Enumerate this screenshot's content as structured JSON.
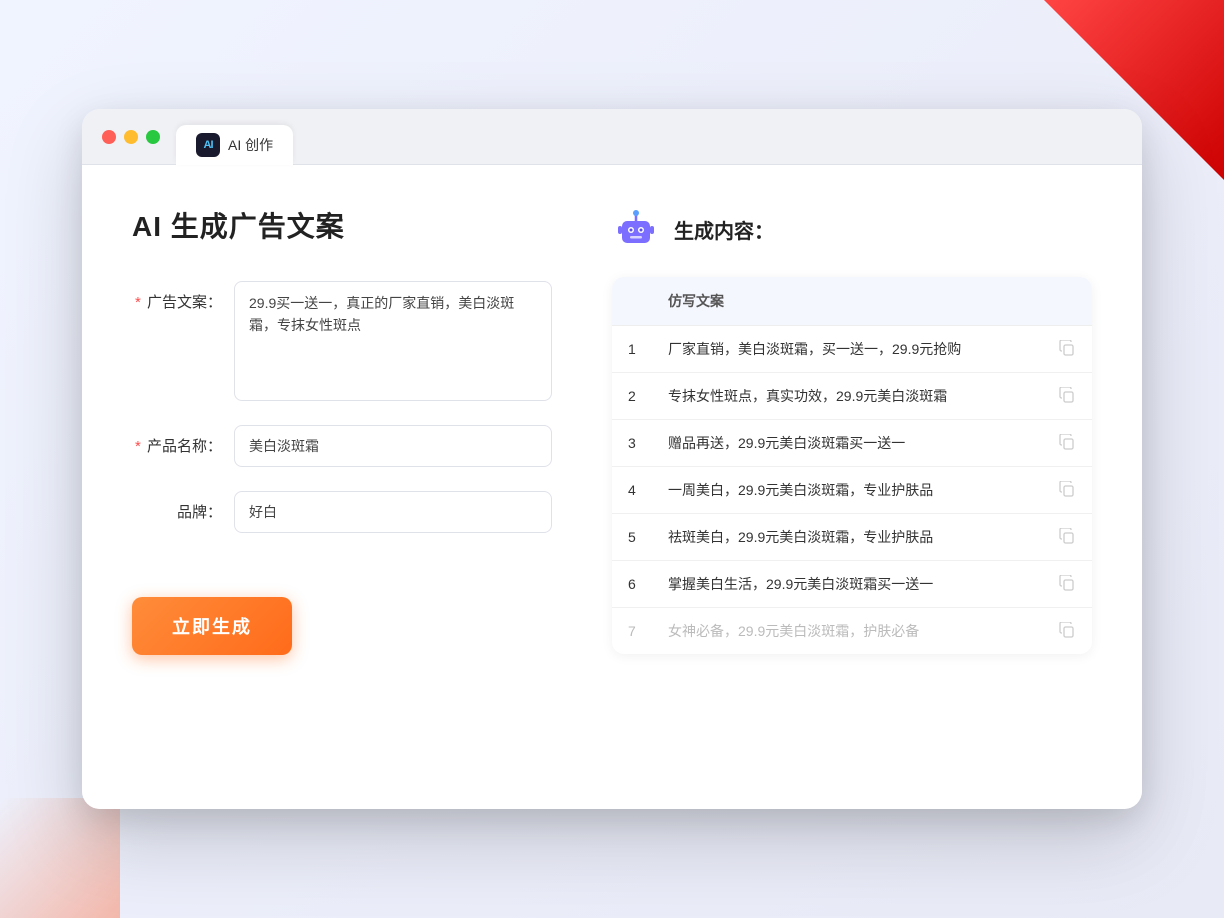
{
  "window": {
    "tab_icon": "AI",
    "tab_label": "AI 创作"
  },
  "left_panel": {
    "page_title": "AI 生成广告文案",
    "form": {
      "ad_copy": {
        "label": "广告文案：",
        "required": true,
        "value": "29.9买一送一，真正的厂家直销，美白淡斑霜，专抹女性斑点"
      },
      "product_name": {
        "label": "产品名称：",
        "required": true,
        "value": "美白淡斑霜"
      },
      "brand": {
        "label": "品牌：",
        "required": false,
        "value": "好白"
      }
    },
    "generate_btn": "立即生成"
  },
  "right_panel": {
    "title": "生成内容：",
    "table": {
      "column_header": "仿写文案",
      "rows": [
        {
          "num": 1,
          "text": "厂家直销，美白淡斑霜，买一送一，29.9元抢购",
          "dimmed": false
        },
        {
          "num": 2,
          "text": "专抹女性斑点，真实功效，29.9元美白淡斑霜",
          "dimmed": false
        },
        {
          "num": 3,
          "text": "赠品再送，29.9元美白淡斑霜买一送一",
          "dimmed": false
        },
        {
          "num": 4,
          "text": "一周美白，29.9元美白淡斑霜，专业护肤品",
          "dimmed": false
        },
        {
          "num": 5,
          "text": "祛斑美白，29.9元美白淡斑霜，专业护肤品",
          "dimmed": false
        },
        {
          "num": 6,
          "text": "掌握美白生活，29.9元美白淡斑霜买一送一",
          "dimmed": false
        },
        {
          "num": 7,
          "text": "女神必备，29.9元美白淡斑霜，护肤必备",
          "dimmed": true
        }
      ]
    }
  }
}
